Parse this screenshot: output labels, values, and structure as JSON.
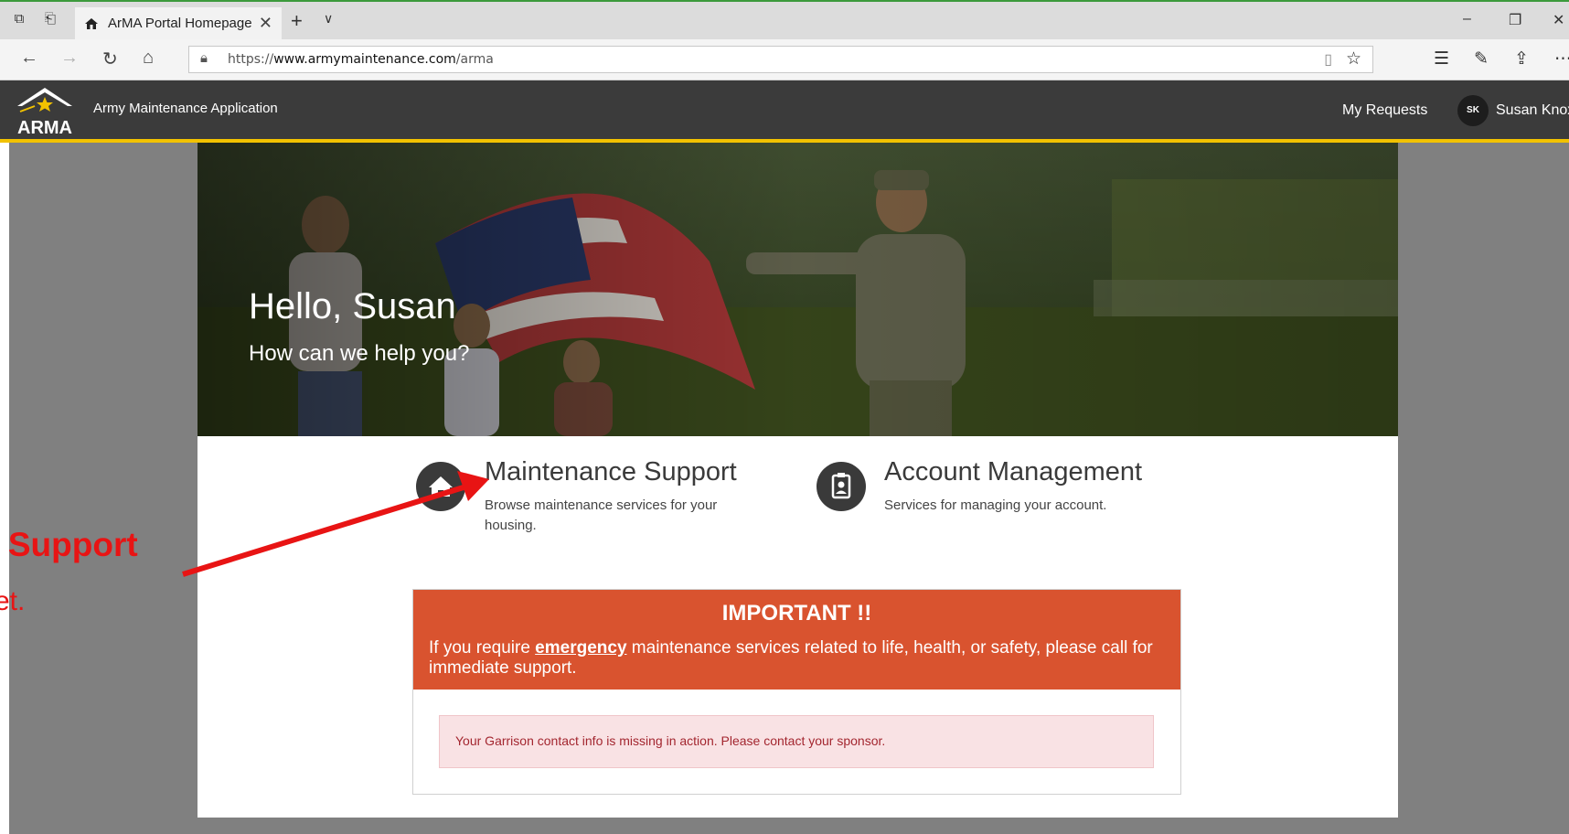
{
  "browser": {
    "tab_title": "ArMA Portal Homepage",
    "url_prefix": "https://",
    "url_host": "www.armymaintenance.com",
    "url_path": "/arma"
  },
  "app": {
    "title": "Army Maintenance Application",
    "logo_text": "ARMA",
    "nav": {
      "my_requests": "My Requests"
    },
    "user": {
      "initials": "SK",
      "name": "Susan Knox"
    }
  },
  "hero": {
    "greeting": "Hello, Susan",
    "subtitle": "How can we help you?"
  },
  "cards": [
    {
      "title": "Maintenance Support",
      "description": "Browse maintenance services for your housing.",
      "icon": "house-icon"
    },
    {
      "title": "Account Management",
      "description": "Services for managing your account.",
      "icon": "id-badge-icon"
    }
  ],
  "important": {
    "title": "IMPORTANT !!",
    "text_before": "If you require ",
    "text_emphasis": "emergency",
    "text_after": " maintenance services related to life, health, or safety, please call for immediate support.",
    "alert": "Your Garrison contact info is missing in action. Please contact your sponsor."
  },
  "annotation": {
    "line1": "e Support",
    "line2": "et.",
    "color": "#e81414"
  },
  "colors": {
    "header": "#3b3b3b",
    "header_accent": "#f2c200",
    "important": "#d9532f",
    "alert_bg": "#f9e2e4",
    "alert_text": "#a3262f"
  }
}
